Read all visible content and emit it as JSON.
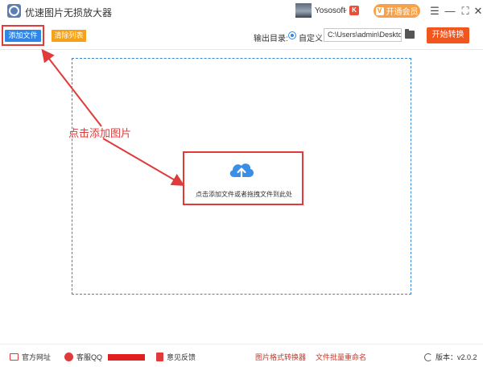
{
  "window": {
    "title": "优速图片无损放大器",
    "user_name": "Yososoft",
    "vip_label": "开通会员",
    "vip_icon": "V",
    "badge": "K"
  },
  "toolbar": {
    "add_label": "添加文件",
    "clear_label": "清除列表",
    "output_label": "输出目录:",
    "radio_label": "自定义",
    "path_value": "C:\\Users\\admin\\Desktop",
    "start_label": "开始转换"
  },
  "workspace": {
    "annotation": "点击添加图片",
    "drop_hint": "点击添加文件或者拖拽文件到此处"
  },
  "footer": {
    "website": "官方网址",
    "qq": "客服QQ",
    "feedback": "意见反馈",
    "format_converter": "图片格式转换器",
    "batch_rename": "文件批量重命名",
    "version": "版本：v2.0.2"
  },
  "colors": {
    "primary": "#2f86e6",
    "accent_orange": "#f5a11a",
    "start_red": "#f0561e",
    "highlight_red": "#e03a3a"
  },
  "icons": {
    "app": "app-logo-icon",
    "cloud": "cloud-upload-icon",
    "folder": "folder-icon",
    "refresh": "refresh-icon"
  }
}
